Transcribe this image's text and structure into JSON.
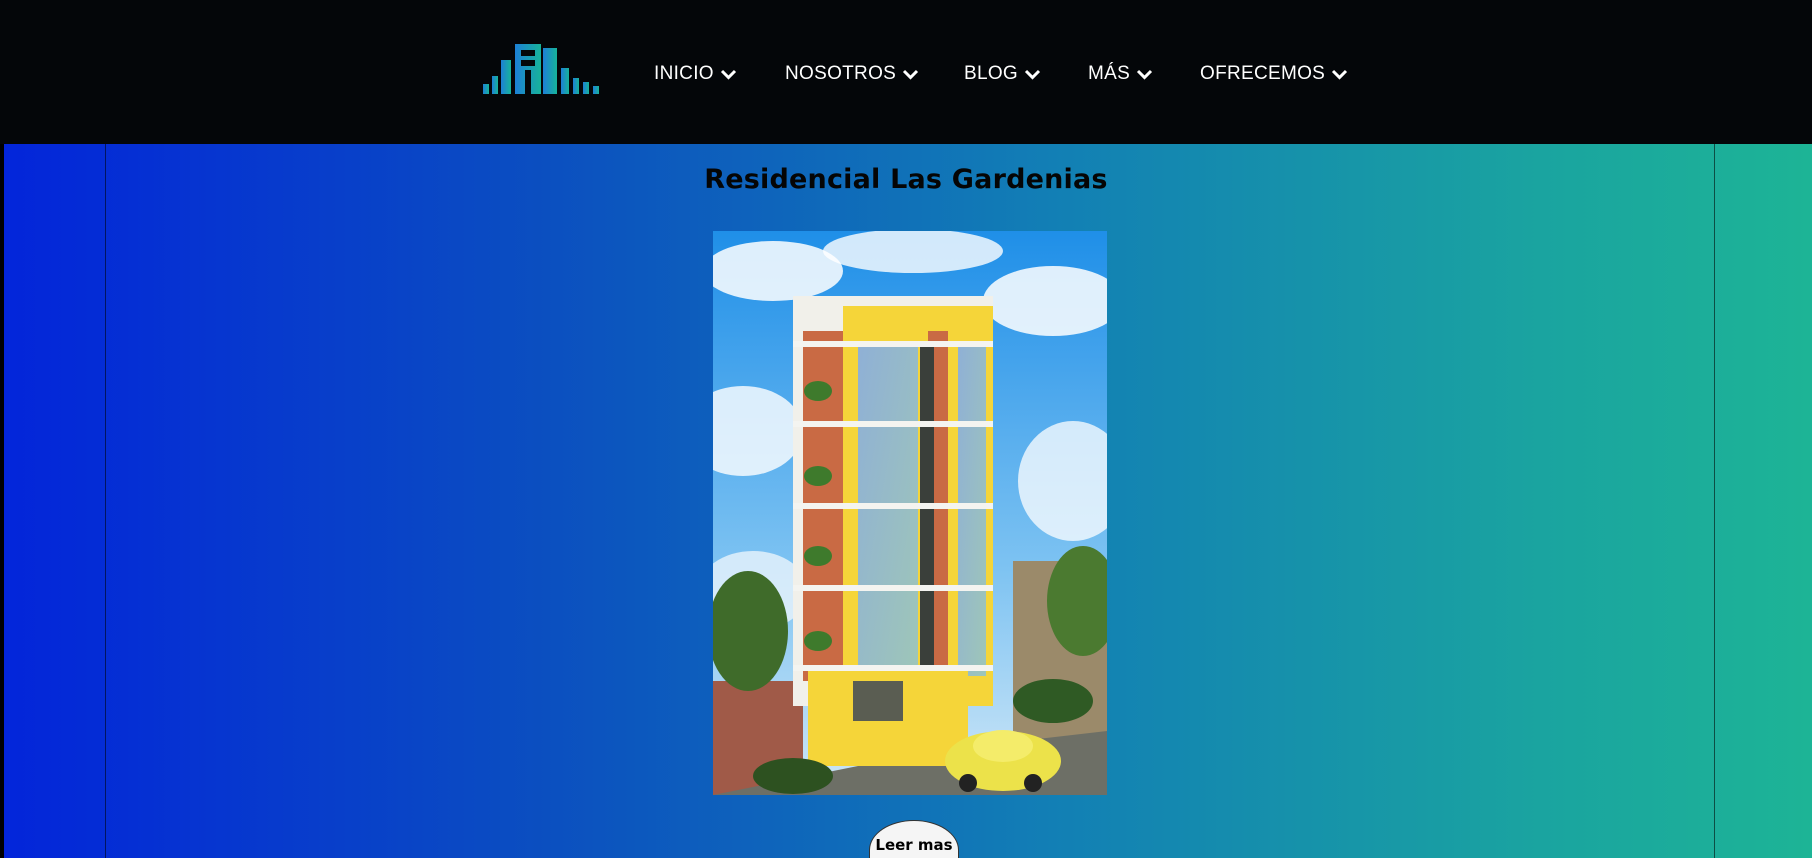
{
  "nav": {
    "items": [
      {
        "label": "INICIO"
      },
      {
        "label": "NOSOTROS"
      },
      {
        "label": "BLOG"
      },
      {
        "label": "MÁS"
      },
      {
        "label": "OFRECEMOS"
      }
    ]
  },
  "colors": {
    "header_bg": "#040609",
    "gradient_start": "#0325da",
    "gradient_end": "#1db496",
    "nav_text": "#ffffff",
    "logo_blue": "#1d7fd6",
    "logo_teal": "#17b39a"
  },
  "icons": {
    "logo": "building-bars-logo-icon",
    "nav_chevron": "chevron-down-icon"
  },
  "main": {
    "title": "Residencial Las Gardenias",
    "image_subject": "building-rendering-image",
    "read_more_label": "Leer mas"
  }
}
